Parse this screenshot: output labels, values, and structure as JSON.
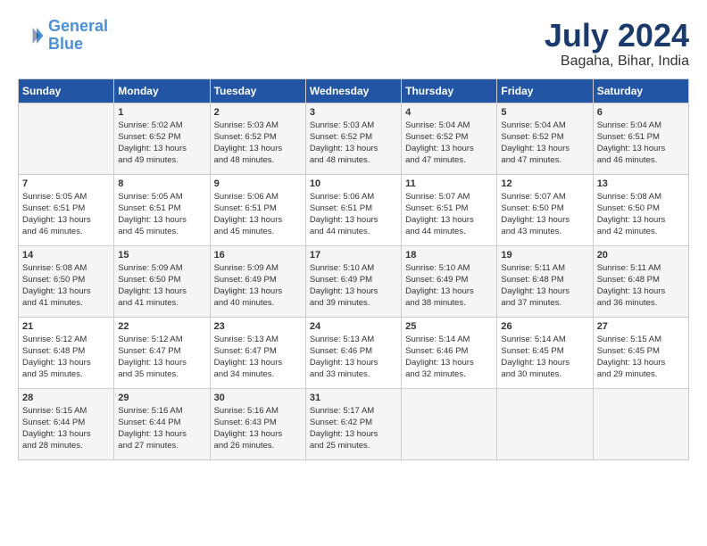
{
  "header": {
    "logo_line1": "General",
    "logo_line2": "Blue",
    "month_year": "July 2024",
    "location": "Bagaha, Bihar, India"
  },
  "days_of_week": [
    "Sunday",
    "Monday",
    "Tuesday",
    "Wednesday",
    "Thursday",
    "Friday",
    "Saturday"
  ],
  "weeks": [
    [
      {
        "day": "",
        "info": ""
      },
      {
        "day": "1",
        "info": "Sunrise: 5:02 AM\nSunset: 6:52 PM\nDaylight: 13 hours\nand 49 minutes."
      },
      {
        "day": "2",
        "info": "Sunrise: 5:03 AM\nSunset: 6:52 PM\nDaylight: 13 hours\nand 48 minutes."
      },
      {
        "day": "3",
        "info": "Sunrise: 5:03 AM\nSunset: 6:52 PM\nDaylight: 13 hours\nand 48 minutes."
      },
      {
        "day": "4",
        "info": "Sunrise: 5:04 AM\nSunset: 6:52 PM\nDaylight: 13 hours\nand 47 minutes."
      },
      {
        "day": "5",
        "info": "Sunrise: 5:04 AM\nSunset: 6:52 PM\nDaylight: 13 hours\nand 47 minutes."
      },
      {
        "day": "6",
        "info": "Sunrise: 5:04 AM\nSunset: 6:51 PM\nDaylight: 13 hours\nand 46 minutes."
      }
    ],
    [
      {
        "day": "7",
        "info": "Sunrise: 5:05 AM\nSunset: 6:51 PM\nDaylight: 13 hours\nand 46 minutes."
      },
      {
        "day": "8",
        "info": "Sunrise: 5:05 AM\nSunset: 6:51 PM\nDaylight: 13 hours\nand 45 minutes."
      },
      {
        "day": "9",
        "info": "Sunrise: 5:06 AM\nSunset: 6:51 PM\nDaylight: 13 hours\nand 45 minutes."
      },
      {
        "day": "10",
        "info": "Sunrise: 5:06 AM\nSunset: 6:51 PM\nDaylight: 13 hours\nand 44 minutes."
      },
      {
        "day": "11",
        "info": "Sunrise: 5:07 AM\nSunset: 6:51 PM\nDaylight: 13 hours\nand 44 minutes."
      },
      {
        "day": "12",
        "info": "Sunrise: 5:07 AM\nSunset: 6:50 PM\nDaylight: 13 hours\nand 43 minutes."
      },
      {
        "day": "13",
        "info": "Sunrise: 5:08 AM\nSunset: 6:50 PM\nDaylight: 13 hours\nand 42 minutes."
      }
    ],
    [
      {
        "day": "14",
        "info": "Sunrise: 5:08 AM\nSunset: 6:50 PM\nDaylight: 13 hours\nand 41 minutes."
      },
      {
        "day": "15",
        "info": "Sunrise: 5:09 AM\nSunset: 6:50 PM\nDaylight: 13 hours\nand 41 minutes."
      },
      {
        "day": "16",
        "info": "Sunrise: 5:09 AM\nSunset: 6:49 PM\nDaylight: 13 hours\nand 40 minutes."
      },
      {
        "day": "17",
        "info": "Sunrise: 5:10 AM\nSunset: 6:49 PM\nDaylight: 13 hours\nand 39 minutes."
      },
      {
        "day": "18",
        "info": "Sunrise: 5:10 AM\nSunset: 6:49 PM\nDaylight: 13 hours\nand 38 minutes."
      },
      {
        "day": "19",
        "info": "Sunrise: 5:11 AM\nSunset: 6:48 PM\nDaylight: 13 hours\nand 37 minutes."
      },
      {
        "day": "20",
        "info": "Sunrise: 5:11 AM\nSunset: 6:48 PM\nDaylight: 13 hours\nand 36 minutes."
      }
    ],
    [
      {
        "day": "21",
        "info": "Sunrise: 5:12 AM\nSunset: 6:48 PM\nDaylight: 13 hours\nand 35 minutes."
      },
      {
        "day": "22",
        "info": "Sunrise: 5:12 AM\nSunset: 6:47 PM\nDaylight: 13 hours\nand 35 minutes."
      },
      {
        "day": "23",
        "info": "Sunrise: 5:13 AM\nSunset: 6:47 PM\nDaylight: 13 hours\nand 34 minutes."
      },
      {
        "day": "24",
        "info": "Sunrise: 5:13 AM\nSunset: 6:46 PM\nDaylight: 13 hours\nand 33 minutes."
      },
      {
        "day": "25",
        "info": "Sunrise: 5:14 AM\nSunset: 6:46 PM\nDaylight: 13 hours\nand 32 minutes."
      },
      {
        "day": "26",
        "info": "Sunrise: 5:14 AM\nSunset: 6:45 PM\nDaylight: 13 hours\nand 30 minutes."
      },
      {
        "day": "27",
        "info": "Sunrise: 5:15 AM\nSunset: 6:45 PM\nDaylight: 13 hours\nand 29 minutes."
      }
    ],
    [
      {
        "day": "28",
        "info": "Sunrise: 5:15 AM\nSunset: 6:44 PM\nDaylight: 13 hours\nand 28 minutes."
      },
      {
        "day": "29",
        "info": "Sunrise: 5:16 AM\nSunset: 6:44 PM\nDaylight: 13 hours\nand 27 minutes."
      },
      {
        "day": "30",
        "info": "Sunrise: 5:16 AM\nSunset: 6:43 PM\nDaylight: 13 hours\nand 26 minutes."
      },
      {
        "day": "31",
        "info": "Sunrise: 5:17 AM\nSunset: 6:42 PM\nDaylight: 13 hours\nand 25 minutes."
      },
      {
        "day": "",
        "info": ""
      },
      {
        "day": "",
        "info": ""
      },
      {
        "day": "",
        "info": ""
      }
    ]
  ]
}
